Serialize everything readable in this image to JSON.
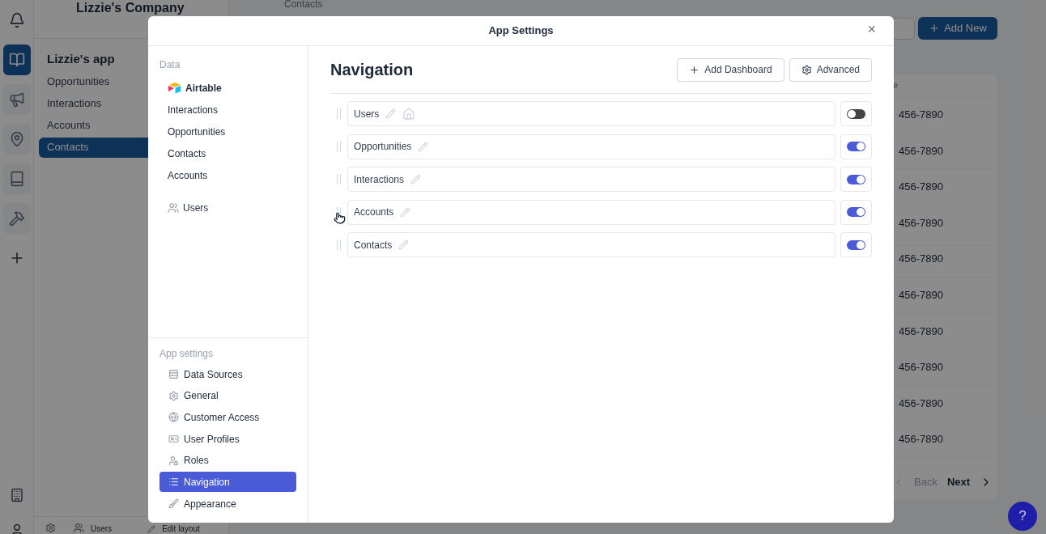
{
  "background": {
    "company": "Lizzie's Company",
    "app_title": "Lizzie's app",
    "nav": [
      {
        "label": "Opportunities",
        "selected": false
      },
      {
        "label": "Interactions",
        "selected": false
      },
      {
        "label": "Accounts",
        "selected": false
      },
      {
        "label": "Contacts",
        "selected": true
      }
    ],
    "breadcrumb": "Contacts",
    "add_button": "Add New",
    "table_header": "e",
    "phones": [
      "456-7890",
      "456-7890",
      "456-7890",
      "456-7890",
      "456-7890",
      "456-7890",
      "456-7890",
      "456-7890",
      "456-7890",
      "456-7890"
    ],
    "pagination": {
      "back": "Back",
      "next": "Next"
    },
    "footer": [
      "Users",
      "Edit layout"
    ],
    "help": "?"
  },
  "modal": {
    "title": "App Settings",
    "close": "×",
    "data_heading": "Data",
    "data_items": [
      {
        "label": "Airtable",
        "kind": "source"
      },
      {
        "label": "Interactions",
        "kind": "table"
      },
      {
        "label": "Opportunities",
        "kind": "table"
      },
      {
        "label": "Contacts",
        "kind": "table"
      },
      {
        "label": "Accounts",
        "kind": "table"
      },
      {
        "label": "Users",
        "kind": "users"
      }
    ],
    "settings_heading": "App settings",
    "settings_items": [
      {
        "label": "Data Sources",
        "selected": false
      },
      {
        "label": "General",
        "selected": false
      },
      {
        "label": "Customer Access",
        "selected": false
      },
      {
        "label": "User Profiles",
        "selected": false
      },
      {
        "label": "Roles",
        "selected": false
      },
      {
        "label": "Navigation",
        "selected": true
      },
      {
        "label": "Appearance",
        "selected": false
      }
    ],
    "page_title": "Navigation",
    "actions": [
      "Add Dashboard",
      "Advanced"
    ],
    "nav_rows": [
      {
        "label": "Users",
        "home": true,
        "on": false
      },
      {
        "label": "Opportunities",
        "home": false,
        "on": true
      },
      {
        "label": "Interactions",
        "home": false,
        "on": true
      },
      {
        "label": "Accounts",
        "home": false,
        "on": true
      },
      {
        "label": "Contacts",
        "home": false,
        "on": true
      }
    ]
  }
}
